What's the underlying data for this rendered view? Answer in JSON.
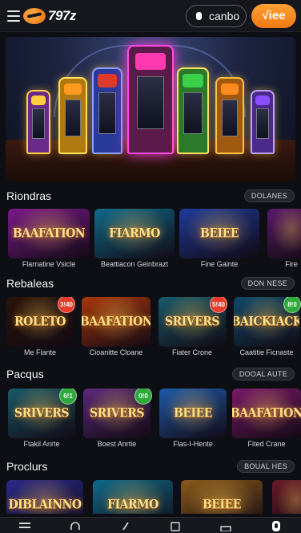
{
  "header": {
    "logo_text": "797z",
    "login_label": "canbo",
    "join_label": "√iee"
  },
  "sections": [
    {
      "title": "Riondras",
      "see_all": "DOLANES",
      "games": [
        {
          "title_art": "BAAFATION",
          "name": "Flarnatine Vsicle",
          "accent": "#7a1a8a"
        },
        {
          "title_art": "FIARMO",
          "name": "Beattiacon Geinbrazt",
          "accent": "#0f6a8a"
        },
        {
          "title_art": "BEIEE",
          "name": "Fine Gainte",
          "accent": "#1f3a9a"
        },
        {
          "title_art": "",
          "name": "Fire",
          "accent": "#5a1a6a"
        }
      ]
    },
    {
      "title": "Rebaleas",
      "see_all": "DON NESE",
      "games": [
        {
          "title_art": "ROLETO",
          "name": "Me Fiante",
          "accent": "#2a1408",
          "badge": "3!40",
          "badge_color": "#e63a2a"
        },
        {
          "title_art": "BAAFATION",
          "name": "Cioanitte Cloane",
          "accent": "#a8360a"
        },
        {
          "title_art": "SRIVERS",
          "name": "Fiater Crone",
          "accent": "#1a5a6a",
          "badge": "5!40",
          "badge_color": "#e63a2a"
        },
        {
          "title_art": "BAICKIACK",
          "name": "Caatitie Ficnaste",
          "accent": "#0f4a6a",
          "badge": "8!0",
          "badge_color": "#2faa3a"
        }
      ]
    },
    {
      "title": "Pacqus",
      "see_all": "DOOAL AUTE",
      "games": [
        {
          "title_art": "SRIVERS",
          "name": "Ftakil Anrte",
          "accent": "#1a5a6a",
          "badge": "6!1",
          "badge_color": "#2faa3a"
        },
        {
          "title_art": "SRIVERS",
          "name": "Boest Anrtie",
          "accent": "#5a2a7a",
          "badge": "0!0",
          "badge_color": "#2faa3a"
        },
        {
          "title_art": "BEIEE",
          "name": "Flas-I-Hente",
          "accent": "#1f5aaa"
        },
        {
          "title_art": "BAAFATION",
          "name": "Fited Crane",
          "accent": "#7a1a6a"
        }
      ]
    },
    {
      "title": "Proclurs",
      "see_all": "BOUAL HES",
      "games": [
        {
          "title_art": "DIBLAINNO",
          "name": "",
          "accent": "#2a2a8a"
        },
        {
          "title_art": "FIARMO",
          "name": "",
          "accent": "#0f6a8a"
        },
        {
          "title_art": "BEIEE",
          "name": "",
          "accent": "#8a5a1a"
        },
        {
          "title_art": "",
          "name": "",
          "accent": "#6a1a2a"
        }
      ]
    }
  ]
}
